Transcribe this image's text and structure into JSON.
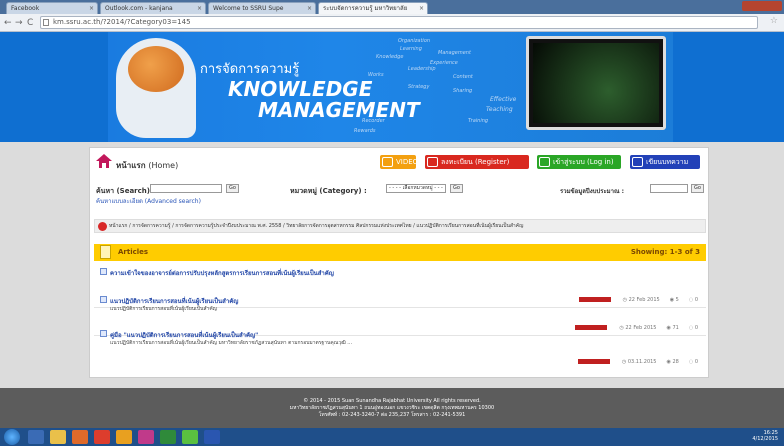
{
  "browser": {
    "tabs": [
      {
        "label": "Facebook"
      },
      {
        "label": "Outlook.com - kanjana"
      },
      {
        "label": "Welcome to SSRU Supe"
      },
      {
        "label": "ระบบจัดการความรู้ มหาวิทยาลัย"
      }
    ],
    "url": "km.ssru.ac.th/?2014/?Category03=145"
  },
  "banner": {
    "thai_title": "การจัดการความรู้",
    "title_line1": "KNOWLEDGE",
    "title_line2": "MANAGEMENT",
    "tags": [
      "Organization",
      "Learning",
      "Management",
      "Knowledge",
      "Works",
      "Leadership",
      "Content",
      "Strategy",
      "Sharing",
      "Effective",
      "Teaching",
      "Training",
      "Rewards",
      "Experience",
      "Recorder"
    ]
  },
  "nav": {
    "home": "หน้าแรก",
    "home_en": "(Home)",
    "video": "VIDEO",
    "register": "ลงทะเบียน (Register)",
    "login": "เข้าสู่ระบบ (Log in)",
    "write": "เขียนบทความ"
  },
  "search": {
    "label": "ค้นหา (Search):",
    "go": "Go",
    "advanced": "ค้นหาแบบละเอียด (Advanced search)",
    "category_label": "หมวดหมู่ (Category) :",
    "category_value": "- - - - เลือกหมวดหมู่ - - -",
    "all_label": "รวมข้อมูลปีงบประมาณ :"
  },
  "breadcrumb": "หน้าแรก / การจัดการความรู้ / การจัดการความรู้ประจำปีงบประมาณ พ.ศ. 2558 / วิทยาลัยการจัดการอุตสาหกรรม ศิลปกรรมแห่งประเทศไทย / แนวปฏิบัติการเรียนการสอนที่เน้นผู้เรียนเป็นสำคัญ",
  "articles": {
    "header": "Articles",
    "showing": "Showing: 1-3 of 3",
    "items": [
      {
        "title": "ความเข้าใจของอาจารย์ต่อการปรับปรุงหลักสูตรการเรียนการสอนที่เน้นผู้เรียนเป็นสำคัญ",
        "desc": "",
        "date": "22 Feb 2015",
        "views": "5",
        "comments": "0"
      },
      {
        "title": "แนวปฏิบัติการเรียนการสอนที่เน้นผู้เรียนเป็นสำคัญ",
        "desc": "แนวปฏิบัติการเรียนการสอนที่เน้นผู้เรียนเป็นสำคัญ",
        "date": "22 Feb 2015",
        "views": "71",
        "comments": "0"
      },
      {
        "title": "คู่มือ \"แนวปฏิบัติการเรียนการสอนที่เน้นผู้เรียนเป็นสำคัญ\"",
        "desc": "แนวปฏิบัติการเรียนการสอนที่เน้นผู้เรียนเป็นสำคัญ มหาวิทยาลัยราชภัฏสวนสุนันทา ตามกรอบมาตรฐานคุณวุฒิ ...",
        "date": "03.11.2015",
        "views": "28",
        "comments": "0"
      }
    ]
  },
  "footer": {
    "line1": "© 2014 - 2015 Suan Sunandha Rajabhat University All rights reserved.",
    "line2": "มหาวิทยาลัยราชภัฏสวนสุนันทา 1 ถนนอู่ทองนอก แขวงวชิระ เขตดุสิต กรุงเทพมหานคร 10300",
    "line3": "โทรศัพท์ : 02-243-3240-7 ต่อ 235,237 โทรสาร : 02-241-5391"
  },
  "taskbar": {
    "time": "16:25",
    "date": "4/12/2015"
  },
  "colors": {
    "banner": "#0f6fd1",
    "articles_bar": "#ffcc00",
    "video": "#f3a010",
    "register": "#d9281f",
    "login": "#2aa626",
    "write": "#2241b8"
  }
}
